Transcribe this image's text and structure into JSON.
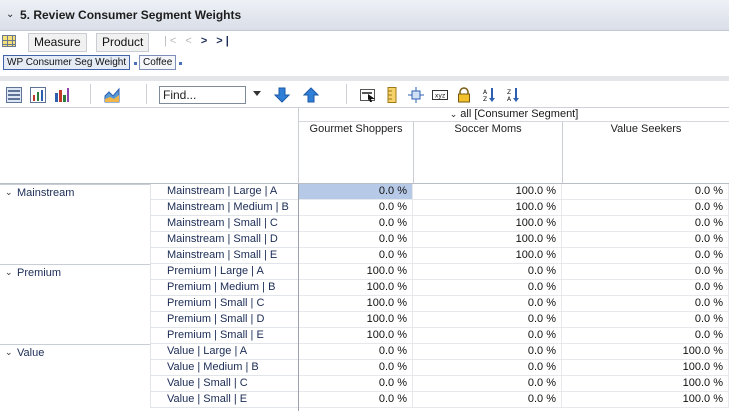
{
  "window": {
    "title": "5. Review Consumer Segment Weights"
  },
  "toolbar_top": {
    "measure_label": "Measure",
    "product_label": "Product",
    "nav_disabled": "|< <",
    "nav_enabled": "> >|"
  },
  "context": {
    "chips": [
      "WP Consumer Seg Weight",
      "Coffee"
    ]
  },
  "toolbar": {
    "find_placeholder": "Find...",
    "icons": [
      "table-view-icon",
      "chart-table-icon",
      "bar-chart-icon",
      "area-chart-icon",
      "find-dropdown-icon",
      "arrow-down-icon",
      "arrow-up-icon",
      "select-icon",
      "ruler-icon",
      "spread-icon",
      "xyz-icon",
      "lock-icon",
      "sort-ascending-icon",
      "sort-descending-icon"
    ]
  },
  "grid": {
    "header_all": "all [Consumer Segment]",
    "columns": [
      "Gourmet Shoppers",
      "Soccer Moms",
      "Value Seekers"
    ],
    "groups": [
      {
        "name": "Mainstream",
        "rows": [
          {
            "label": "Mainstream | Large | A",
            "values": [
              "0.0 %",
              "100.0 %",
              "0.0 %"
            ]
          },
          {
            "label": "Mainstream | Medium | B",
            "values": [
              "0.0 %",
              "100.0 %",
              "0.0 %"
            ]
          },
          {
            "label": "Mainstream | Small | C",
            "values": [
              "0.0 %",
              "100.0 %",
              "0.0 %"
            ]
          },
          {
            "label": "Mainstream | Small | D",
            "values": [
              "0.0 %",
              "100.0 %",
              "0.0 %"
            ]
          },
          {
            "label": "Mainstream | Small | E",
            "values": [
              "0.0 %",
              "100.0 %",
              "0.0 %"
            ]
          }
        ]
      },
      {
        "name": "Premium",
        "rows": [
          {
            "label": "Premium | Large | A",
            "values": [
              "100.0 %",
              "0.0 %",
              "0.0 %"
            ]
          },
          {
            "label": "Premium | Medium | B",
            "values": [
              "100.0 %",
              "0.0 %",
              "0.0 %"
            ]
          },
          {
            "label": "Premium | Small | C",
            "values": [
              "100.0 %",
              "0.0 %",
              "0.0 %"
            ]
          },
          {
            "label": "Premium | Small | D",
            "values": [
              "100.0 %",
              "0.0 %",
              "0.0 %"
            ]
          },
          {
            "label": "Premium | Small | E",
            "values": [
              "100.0 %",
              "0.0 %",
              "0.0 %"
            ]
          }
        ]
      },
      {
        "name": "Value",
        "rows": [
          {
            "label": "Value | Large | A",
            "values": [
              "0.0 %",
              "0.0 %",
              "100.0 %"
            ]
          },
          {
            "label": "Value | Medium | B",
            "values": [
              "0.0 %",
              "0.0 %",
              "100.0 %"
            ]
          },
          {
            "label": "Value | Small | C",
            "values": [
              "0.0 %",
              "0.0 %",
              "100.0 %"
            ]
          },
          {
            "label": "Value | Small | E",
            "values": [
              "0.0 %",
              "0.0 %",
              "100.0 %"
            ]
          }
        ]
      }
    ]
  },
  "colors": {
    "selected_cell": "#b6c9e6",
    "title_bar": "#d9dee8",
    "link_text": "#1a2b55"
  }
}
